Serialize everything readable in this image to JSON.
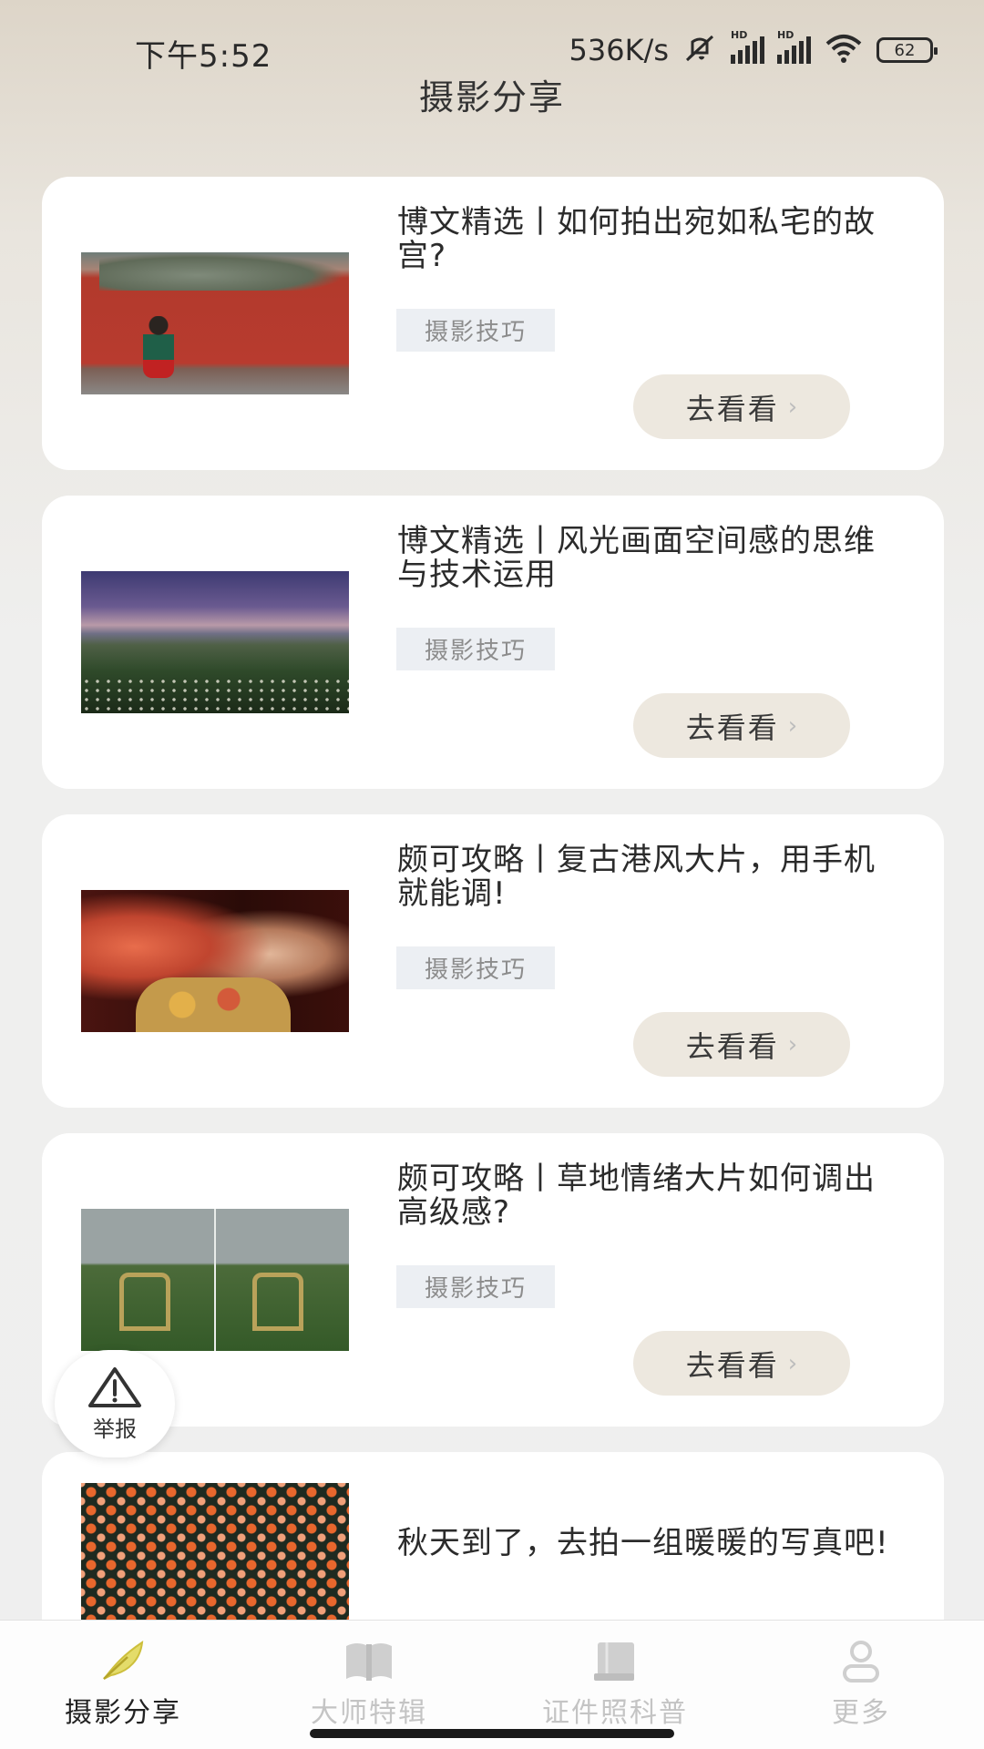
{
  "status_bar": {
    "time": "下午5:52",
    "net_speed": "536K/s",
    "battery": "62",
    "hd_label": "HD"
  },
  "header": {
    "title": "摄影分享"
  },
  "articles": [
    {
      "title": "博文精选丨如何拍出宛如私宅的故宫?",
      "tag": "摄影技巧",
      "button": "去看看"
    },
    {
      "title": "博文精选丨风光画面空间感的思维与技术运用",
      "tag": "摄影技巧",
      "button": "去看看"
    },
    {
      "title": "颇可攻略丨复古港风大片，用手机就能调!",
      "tag": "摄影技巧",
      "button": "去看看"
    },
    {
      "title": "颇可攻略丨草地情绪大片如何调出高级感?",
      "tag": "摄影技巧",
      "button": "去看看"
    },
    {
      "title": "秋天到了，去拍一组暖暖的写真吧!"
    }
  ],
  "report_button": {
    "label": "举报"
  },
  "tab_bar": {
    "items": [
      {
        "label": "摄影分享",
        "icon": "feather-icon",
        "active": true
      },
      {
        "label": "大师特辑",
        "icon": "open-book-icon",
        "active": false
      },
      {
        "label": "证件照科普",
        "icon": "book-icon",
        "active": false
      },
      {
        "label": "更多",
        "icon": "person-icon",
        "active": false
      }
    ]
  },
  "colors": {
    "accent": "#d8c84a",
    "button_bg": "#ede8df",
    "tag_bg": "#eceff3",
    "inactive_tab": "#c4c4c4"
  }
}
